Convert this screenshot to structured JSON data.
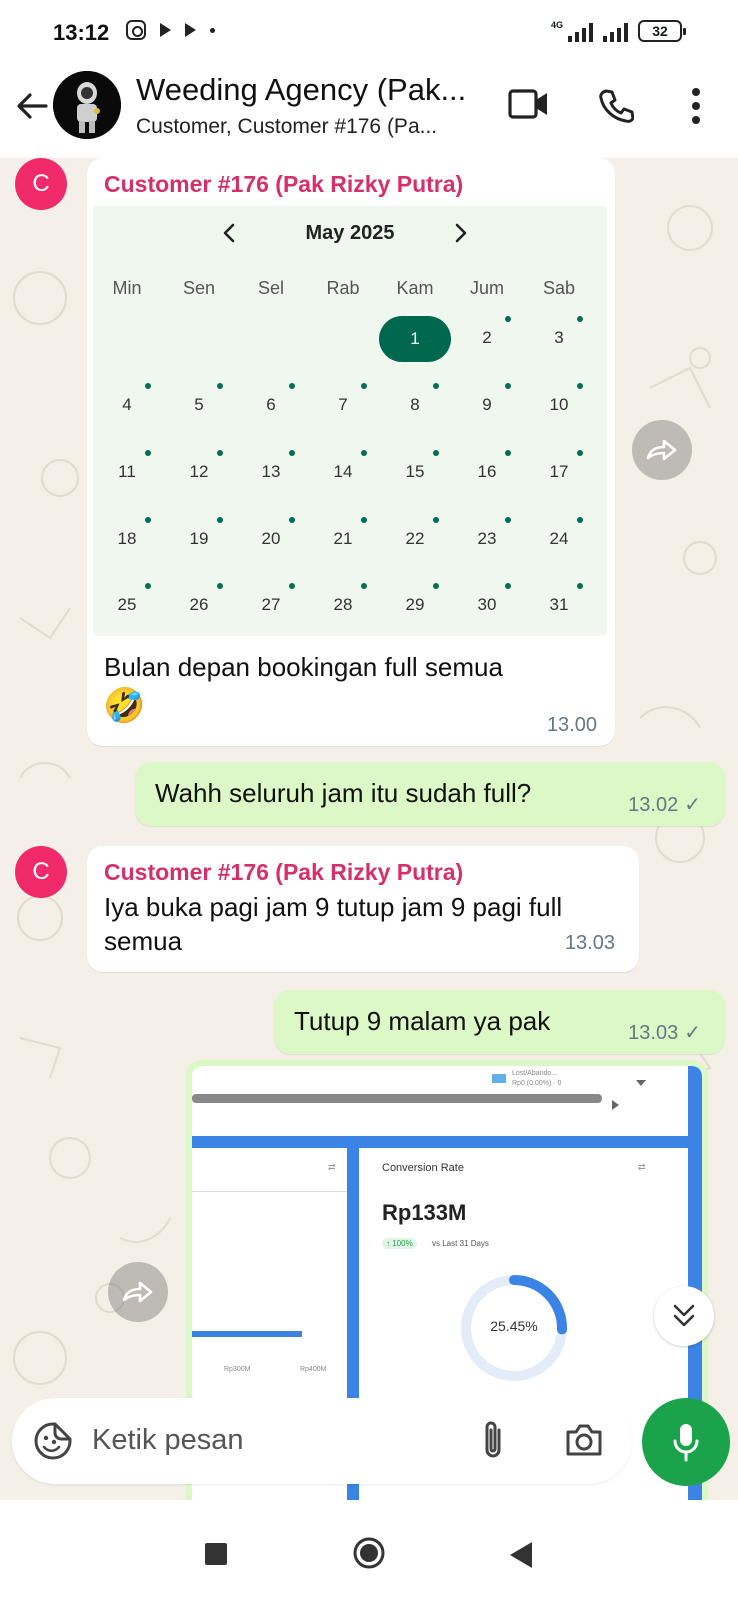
{
  "status_bar": {
    "time": "13:12",
    "network": "4G",
    "battery": "32"
  },
  "header": {
    "title": "Weeding Agency (Pak...",
    "subtitle": "Customer, Customer #176 (Pa...",
    "icons": [
      "back-arrow-icon",
      "video-call-icon",
      "phone-call-icon",
      "more-vertical-icon"
    ]
  },
  "messages": {
    "m1": {
      "avatar_letter": "C",
      "sender": "Customer #176 (Pak Rizky Putra)",
      "calendar": {
        "month": "May 2025",
        "weekdays": [
          "Min",
          "Sen",
          "Sel",
          "Rab",
          "Kam",
          "Jum",
          "Sab"
        ],
        "first_weekday_index": 4,
        "days_in_month": 31,
        "selected_day": 1,
        "dotted_from_day": 2
      },
      "text": "Bulan depan bookingan full semua",
      "emoji": "🤣",
      "time": "13.00"
    },
    "m2": {
      "text": "Wahh seluruh jam itu sudah full?",
      "time": "13.02",
      "status": "✓"
    },
    "m3": {
      "avatar_letter": "C",
      "sender": "Customer #176 (Pak Rizky Putra)",
      "text": "Iya buka pagi jam 9 tutup jam 9 pagi full semua",
      "time": "13.03"
    },
    "m4": {
      "text": "Tutup 9 malam ya pak",
      "time": "13.03",
      "status": "✓"
    },
    "m5_image": {
      "card_title": "Conversion Rate",
      "value": "Rp133M",
      "change": "↑ 100%",
      "compare": "vs Last 31 Days",
      "donut_label": "25.45%",
      "donut_value": 0.2545,
      "legend_line1": "Lost/Abando...",
      "legend_line2": "Rp0 (0.00%) · 0",
      "axis_left": "Rp300M",
      "axis_right": "Rp400M"
    }
  },
  "input": {
    "placeholder": "Ketik pesan",
    "icons": [
      "sticker-icon",
      "attach-icon",
      "camera-icon",
      "mic-icon"
    ]
  },
  "nav": {
    "icons": [
      "recents-square-icon",
      "home-circle-icon",
      "back-triangle-icon"
    ]
  }
}
